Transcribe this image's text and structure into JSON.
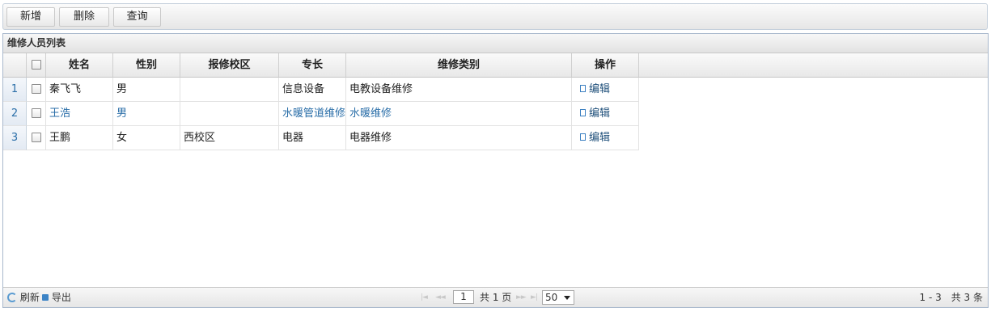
{
  "toolbar": {
    "add_label": "新增",
    "delete_label": "删除",
    "query_label": "查询"
  },
  "grid": {
    "caption": "维修人员列表",
    "columns": {
      "name": "姓名",
      "gender": "性别",
      "campus": "报修校区",
      "specialty": "专长",
      "category": "维修类别",
      "action": "操作"
    },
    "rows": [
      {
        "rownum": "1",
        "name": "秦飞飞",
        "gender": "男",
        "campus": "",
        "specialty": "信息设备",
        "category": "电教设备维修",
        "action": "编辑",
        "highlighted": false
      },
      {
        "rownum": "2",
        "name": "王浩",
        "gender": "男",
        "campus": "",
        "specialty": "水暖管道维修",
        "category": "水暖维修",
        "action": "编辑",
        "highlighted": true
      },
      {
        "rownum": "3",
        "name": "王鹏",
        "gender": "女",
        "campus": "西校区",
        "specialty": "电器",
        "category": "电器维修",
        "action": "编辑",
        "highlighted": false
      }
    ]
  },
  "pager": {
    "refresh_label": "刷新",
    "export_label": "导出",
    "page_input": "1",
    "total_pages": "共 1 页",
    "page_size": "50",
    "record_info": "1 - 3　共 3 条"
  },
  "colors": {
    "accent": "#2a6ea8",
    "border": "#a8b8cc"
  }
}
